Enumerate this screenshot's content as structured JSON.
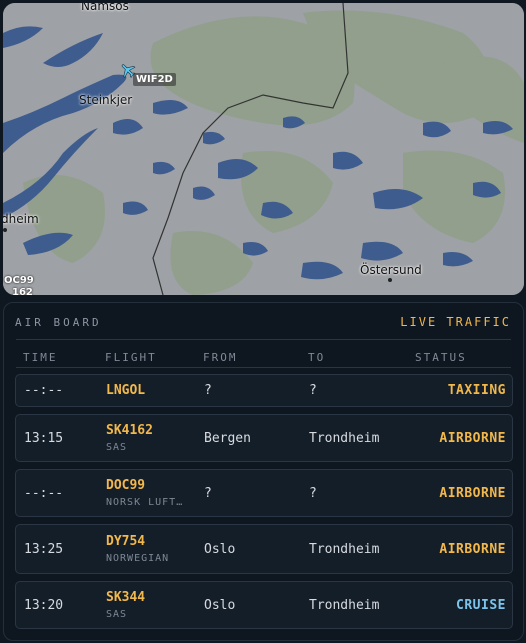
{
  "map": {
    "places": [
      {
        "name": "Namsos"
      },
      {
        "name": "Steinkjer"
      },
      {
        "name": "dheim"
      },
      {
        "name": "Östersund"
      }
    ],
    "aircraft_tag": "WIF2D",
    "edge_tags": [
      "OC99",
      "162"
    ],
    "colors": {
      "land": "#9c9fa2",
      "forest": "#8e9e87",
      "water": "#3d5b8c",
      "border": "#3a3a3a"
    }
  },
  "board": {
    "title": "AIR BOARD",
    "live_label": "LIVE TRAFFIC",
    "columns": [
      "TIME",
      "FLIGHT",
      "FROM",
      "TO",
      "STATUS"
    ],
    "rows": [
      {
        "time": "--:--",
        "flight": "LNGOL",
        "airline": "",
        "from": "?",
        "to": "?",
        "status": "TAXIING",
        "status_color": "#f2b84b"
      },
      {
        "time": "13:15",
        "flight": "SK4162",
        "airline": "SAS",
        "from": "Bergen",
        "to": "Trondheim",
        "status": "AIRBORNE",
        "status_color": "#f2b84b"
      },
      {
        "time": "--:--",
        "flight": "DOC99",
        "airline": "NORSK LUFT…",
        "from": "?",
        "to": "?",
        "status": "AIRBORNE",
        "status_color": "#f2b84b"
      },
      {
        "time": "13:25",
        "flight": "DY754",
        "airline": "NORWEGIAN",
        "from": "Oslo",
        "to": "Trondheim",
        "status": "AIRBORNE",
        "status_color": "#f2b84b"
      },
      {
        "time": "13:20",
        "flight": "SK344",
        "airline": "SAS",
        "from": "Oslo",
        "to": "Trondheim",
        "status": "CRUISE",
        "status_color": "#7cc4ec"
      }
    ]
  }
}
